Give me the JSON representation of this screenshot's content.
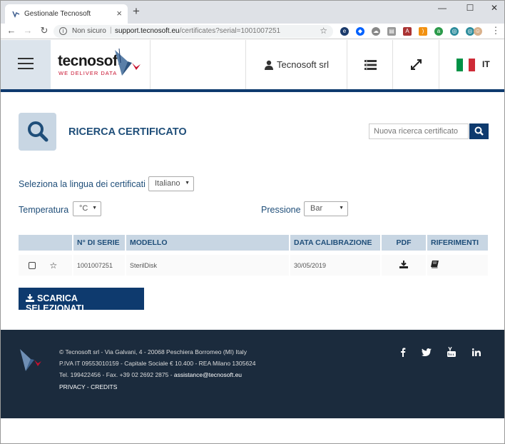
{
  "browser": {
    "tab_title": "Gestionale Tecnosoft",
    "security_label": "Non sicuro",
    "url_host": "support.tecnosoft.eu",
    "url_path": "/certificates?serial=1001007251"
  },
  "header": {
    "logo_text": "tecnosoft",
    "logo_tagline": "WE DELIVER DATA",
    "company": "Tecnosoft srl",
    "language": "IT"
  },
  "page": {
    "title": "RICERCA CERTIFICATO",
    "search_placeholder": "Nuova ricerca certificato",
    "language_label": "Seleziona la lingua dei certificati",
    "language_value": "Italiano",
    "temperature_label": "Temperatura",
    "temperature_value": "°C",
    "pressure_label": "Pressione",
    "pressure_value": "Bar",
    "download_button": "SCARICA SELEZIONATI"
  },
  "table": {
    "headers": [
      "N° DI SERIE",
      "MODELLO",
      "DATA CALIBRAZIONE",
      "PDF",
      "RIFERIMENTI"
    ],
    "rows": [
      {
        "serial": "1001007251",
        "model": "SterilDisk",
        "date": "30/05/2019"
      }
    ]
  },
  "footer": {
    "line1": "© Tecnosoft srl - Via Galvani, 4 - 20068 Peschiera Borromeo (MI) Italy",
    "line2": "P.IVA IT 09553010159 - Capitale Sociale € 10.400 - REA Milano 1305624",
    "line3_prefix": "Tel. 199422456 - Fax. +39 02 2692 2875 - ",
    "email": "assistance@tecnosoft.eu",
    "privacy": "PRIVACY",
    "dash": " - ",
    "credits": "CREDITS",
    "social": [
      "f",
      "t",
      "yt",
      "in"
    ]
  },
  "colors": {
    "brand": "#0e3a6e",
    "accent_light": "#c8d6e3",
    "footer_bg": "#1b2b3d"
  }
}
